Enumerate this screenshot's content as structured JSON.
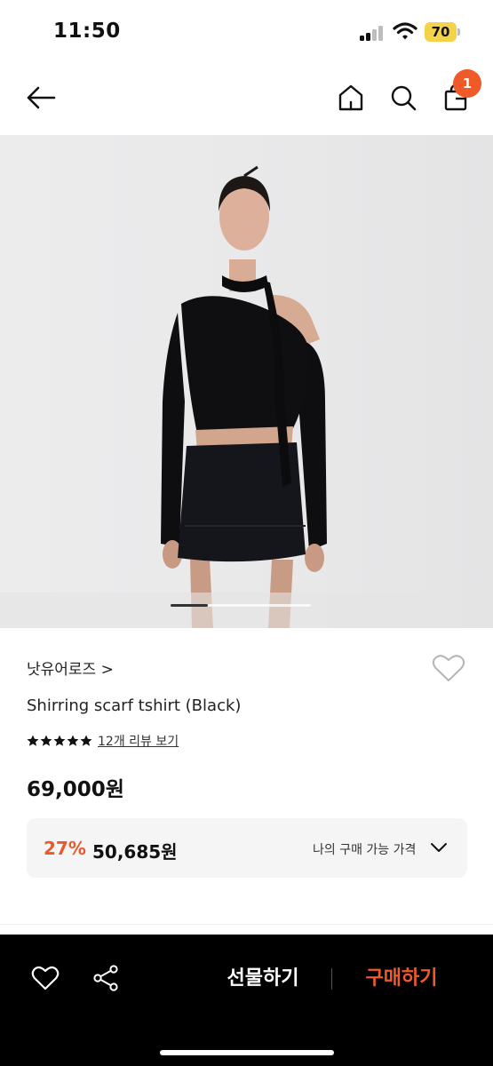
{
  "status_bar": {
    "time": "11:50",
    "battery": "70",
    "battery_color": "#f4d24a"
  },
  "nav": {
    "back_icon": "arrow-left-icon",
    "home_icon": "home-icon",
    "search_icon": "search-icon",
    "cart_icon": "shopping-bag-icon",
    "cart_count": "1",
    "badge_color": "#f05a28"
  },
  "product": {
    "image_description_icon": "product-photo",
    "image_pager": {
      "current": 1,
      "total": 4
    },
    "brand": "낫유어로즈 >",
    "name": "Shirring scarf tshirt (Black)",
    "rating_stars": 5,
    "review_link": "12개 리뷰 보기",
    "price": "69,000원",
    "discount": {
      "rate": "27%",
      "price": "50,685원",
      "label": "나의 구매 가능 가격",
      "rate_color": "#e85a2a"
    }
  },
  "bottom_bar": {
    "like_icon": "heart-outline-icon",
    "share_icon": "share-icon",
    "gift_label": "선물하기",
    "buy_label": "구매하기",
    "buy_color": "#f05a28"
  }
}
